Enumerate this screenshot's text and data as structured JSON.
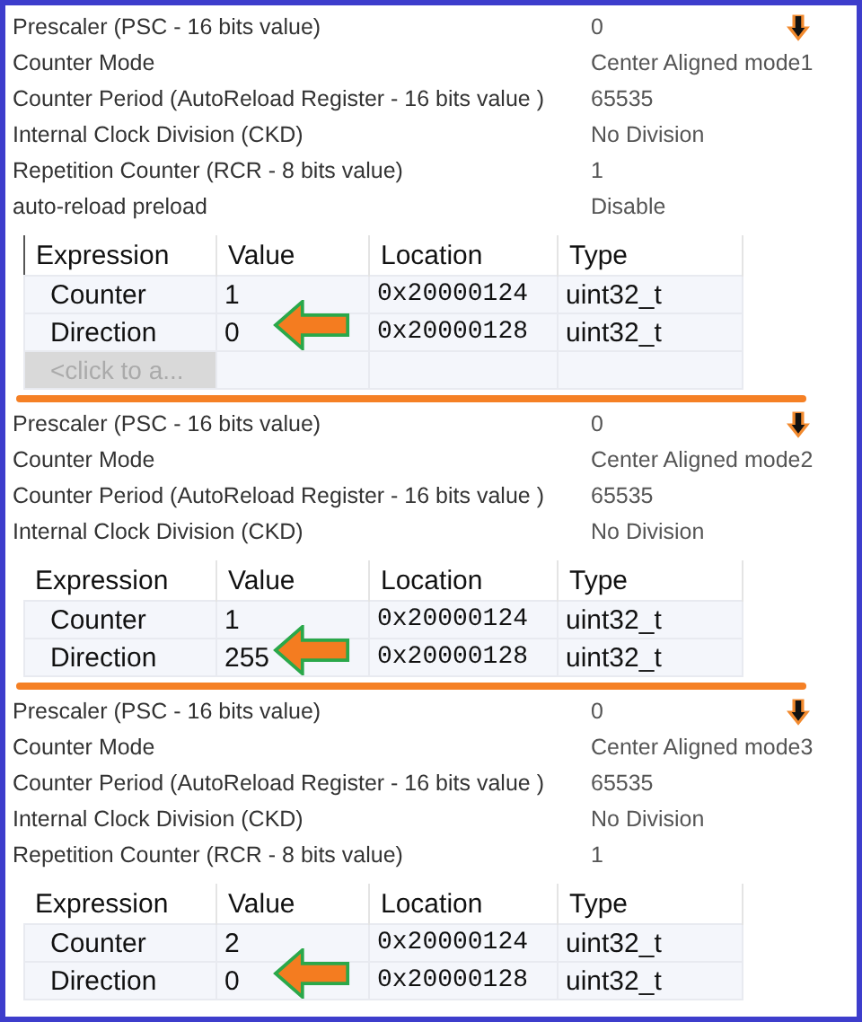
{
  "sections": [
    {
      "params": [
        {
          "label": "Prescaler (PSC - 16 bits value)",
          "value": "0"
        },
        {
          "label": "Counter Mode",
          "value": "Center Aligned mode1"
        },
        {
          "label": "Counter Period (AutoReload Register - 16 bits value )",
          "value": "65535"
        },
        {
          "label": "Internal Clock Division (CKD)",
          "value": "No Division"
        },
        {
          "label": "Repetition Counter (RCR - 8 bits value)",
          "value": "1"
        },
        {
          "label": "auto-reload preload",
          "value": "Disable"
        }
      ],
      "watch": {
        "columns": [
          "Expression",
          "Value",
          "Location",
          "Type"
        ],
        "rows": [
          {
            "expression": "Counter",
            "value": "1",
            "location": "0x20000124",
            "type": "uint32_t"
          },
          {
            "expression": "Direction",
            "value": "0",
            "location": "0x20000128",
            "type": "uint32_t"
          }
        ],
        "add_row": "<click to a..."
      }
    },
    {
      "params": [
        {
          "label": "Prescaler (PSC - 16 bits value)",
          "value": "0"
        },
        {
          "label": "Counter Mode",
          "value": "Center Aligned mode2"
        },
        {
          "label": "Counter Period (AutoReload Register - 16 bits value )",
          "value": "65535"
        },
        {
          "label": "Internal Clock Division (CKD)",
          "value": "No Division"
        }
      ],
      "watch": {
        "columns": [
          "Expression",
          "Value",
          "Location",
          "Type"
        ],
        "rows": [
          {
            "expression": "Counter",
            "value": "1",
            "location": "0x20000124",
            "type": "uint32_t"
          },
          {
            "expression": "Direction",
            "value": "255",
            "location": "0x20000128",
            "type": "uint32_t"
          }
        ]
      }
    },
    {
      "params": [
        {
          "label": "Prescaler (PSC - 16 bits value)",
          "value": "0"
        },
        {
          "label": "Counter Mode",
          "value": "Center Aligned mode3"
        },
        {
          "label": "Counter Period (AutoReload Register - 16 bits value )",
          "value": "65535"
        },
        {
          "label": "Internal Clock Division (CKD)",
          "value": "No Division"
        },
        {
          "label": "Repetition Counter (RCR - 8 bits value)",
          "value": "1"
        }
      ],
      "watch": {
        "columns": [
          "Expression",
          "Value",
          "Location",
          "Type"
        ],
        "rows": [
          {
            "expression": "Counter",
            "value": "2",
            "location": "0x20000124",
            "type": "uint32_t"
          },
          {
            "expression": "Direction",
            "value": "0",
            "location": "0x20000128",
            "type": "uint32_t"
          }
        ]
      }
    }
  ]
}
